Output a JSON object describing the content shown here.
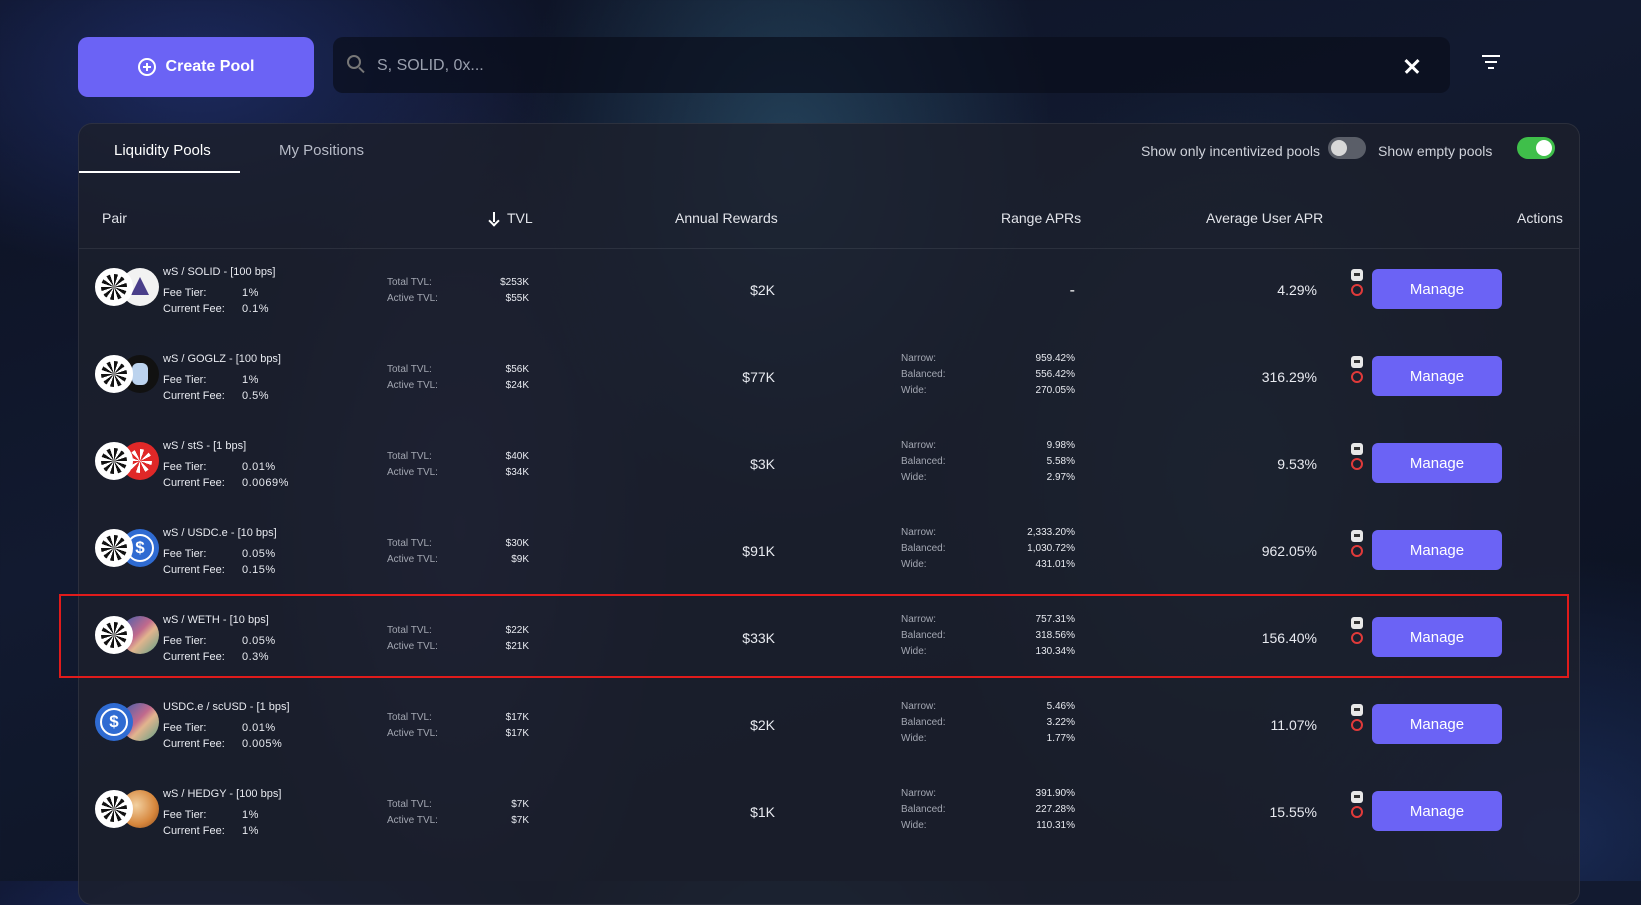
{
  "toolbar": {
    "create_pool_label": "Create Pool",
    "search_placeholder": "S, SOLID, 0x..."
  },
  "tabs": {
    "liquidity_pools": "Liquidity Pools",
    "my_positions": "My Positions"
  },
  "toggles": {
    "incentivized_label": "Show only incentivized pools",
    "incentivized_on": false,
    "empty_label": "Show empty pools",
    "empty_on": true
  },
  "columns": {
    "pair": "Pair",
    "tvl": "TVL",
    "annual_rewards": "Annual Rewards",
    "range_aprs": "Range APRs",
    "avg_user_apr": "Average User APR",
    "actions": "Actions"
  },
  "labels": {
    "fee_tier": "Fee Tier:",
    "current_fee": "Current Fee:",
    "total_tvl": "Total TVL:",
    "active_tvl": "Active TVL:",
    "narrow": "Narrow:",
    "balanced": "Balanced:",
    "wide": "Wide:",
    "manage": "Manage",
    "dash": "-"
  },
  "pools": [
    {
      "name": "wS / SOLID - [100 bps]",
      "fee_tier": "1%",
      "current_fee": "0.1%",
      "total_tvl": "$253K",
      "active_tvl": "$55K",
      "rewards": "$2K",
      "narrow": "",
      "balanced": "",
      "wide": "",
      "avg_apr": "4.29%",
      "icon2": "solid"
    },
    {
      "name": "wS / GOGLZ - [100 bps]",
      "fee_tier": "1%",
      "current_fee": "0.5%",
      "total_tvl": "$56K",
      "active_tvl": "$24K",
      "rewards": "$77K",
      "narrow": "959.42%",
      "balanced": "556.42%",
      "wide": "270.05%",
      "avg_apr": "316.29%",
      "icon2": "goglz"
    },
    {
      "name": "wS / stS - [1 bps]",
      "fee_tier": "0.01%",
      "current_fee": "0.0069%",
      "total_tvl": "$40K",
      "active_tvl": "$34K",
      "rewards": "$3K",
      "narrow": "9.98%",
      "balanced": "5.58%",
      "wide": "2.97%",
      "avg_apr": "9.53%",
      "icon2": "sts"
    },
    {
      "name": "wS / USDC.e - [10 bps]",
      "fee_tier": "0.05%",
      "current_fee": "0.15%",
      "total_tvl": "$30K",
      "active_tvl": "$9K",
      "rewards": "$91K",
      "narrow": "2,333.20%",
      "balanced": "1,030.72%",
      "wide": "431.01%",
      "avg_apr": "962.05%",
      "icon2": "usdce"
    },
    {
      "name": "wS / WETH - [10 bps]",
      "fee_tier": "0.05%",
      "current_fee": "0.3%",
      "total_tvl": "$22K",
      "active_tvl": "$21K",
      "rewards": "$33K",
      "narrow": "757.31%",
      "balanced": "318.56%",
      "wide": "130.34%",
      "avg_apr": "156.40%",
      "icon2": "weth"
    },
    {
      "name": "USDC.e / scUSD - [1 bps]",
      "fee_tier": "0.01%",
      "current_fee": "0.005%",
      "total_tvl": "$17K",
      "active_tvl": "$17K",
      "rewards": "$2K",
      "narrow": "5.46%",
      "balanced": "3.22%",
      "wide": "1.77%",
      "avg_apr": "11.07%",
      "icon2": "scusd"
    },
    {
      "name": "wS / HEDGY - [100 bps]",
      "fee_tier": "1%",
      "current_fee": "1%",
      "total_tvl": "$7K",
      "active_tvl": "$7K",
      "rewards": "$1K",
      "narrow": "391.90%",
      "balanced": "227.28%",
      "wide": "110.31%",
      "avg_apr": "15.55%",
      "icon2": "hedgy"
    }
  ],
  "colors": {
    "accent": "#6b63f5",
    "highlight": "#e01b1b",
    "toggle_on": "#3fbf4a"
  }
}
